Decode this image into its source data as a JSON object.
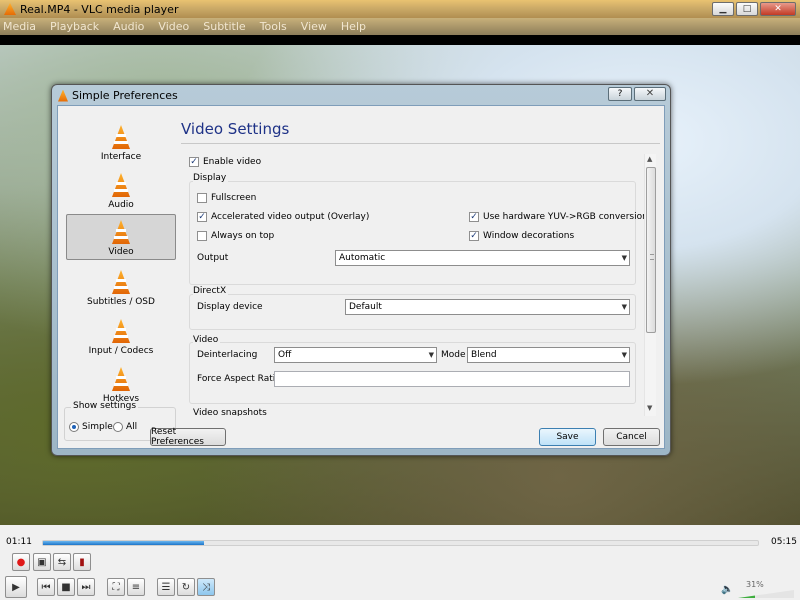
{
  "window": {
    "title": "Real.MP4 - VLC media player",
    "minimize": "0",
    "maximize": "1",
    "close": "r"
  },
  "menu": [
    "Media",
    "Playback",
    "Audio",
    "Video",
    "Subtitle",
    "Tools",
    "View",
    "Help"
  ],
  "player": {
    "time_elapsed": "01:11",
    "time_total": "05:15",
    "volume": "31%",
    "progress": 0.225
  },
  "dialog": {
    "title": "Simple Preferences",
    "help": "?",
    "close": "✕",
    "sidebar": [
      "Interface",
      "Audio",
      "Video",
      "Subtitles / OSD",
      "Input / Codecs",
      "Hotkeys"
    ],
    "show_settings": {
      "legend": "Show settings",
      "simple": "Simple",
      "all": "All"
    },
    "reset": "Reset Preferences",
    "save": "Save",
    "cancel": "Cancel",
    "heading": "Video Settings",
    "enable_video": "Enable video",
    "display": {
      "label": "Display",
      "fullscreen": "Fullscreen",
      "accel": "Accelerated video output (Overlay)",
      "yuv": "Use hardware YUV->RGB conversions",
      "ontop": "Always on top",
      "decorations": "Window decorations",
      "output_label": "Output",
      "output_value": "Automatic"
    },
    "directx": {
      "label": "DirectX",
      "device_label": "Display device",
      "device_value": "Default"
    },
    "video": {
      "label": "Video",
      "deint_label": "Deinterlacing",
      "deint_value": "Off",
      "mode_label": "Mode",
      "mode_value": "Blend",
      "aspect_label": "Force Aspect Ratio",
      "aspect_value": ""
    },
    "snapshots": "Video snapshots"
  },
  "colors": {
    "accent": "#1e3287",
    "orange": "#f08a12",
    "seek": "#1c75c9"
  }
}
